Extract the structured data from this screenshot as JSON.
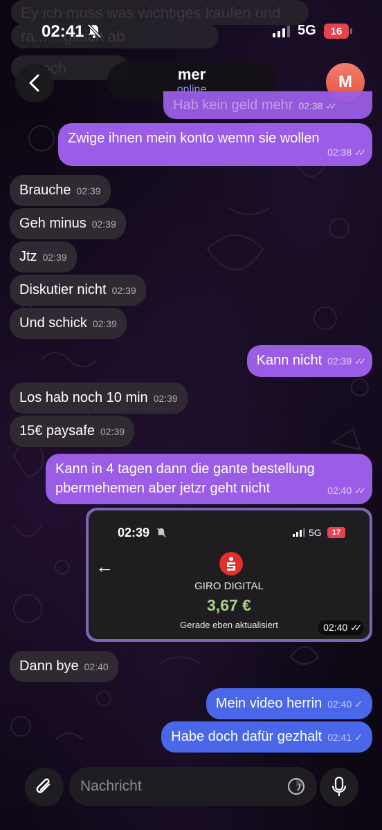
{
  "status_bar": {
    "time": "02:41",
    "network": "5G",
    "battery": "16"
  },
  "background_preview": {
    "line1": "Ey ich muss was wichtiges kaufen und",
    "line2": "ra... ...gleich ab",
    "line3": "...noch"
  },
  "header": {
    "contact_name": "mer",
    "contact_status": "online",
    "avatar_letter": "M"
  },
  "messages": [
    {
      "dir": "out",
      "text": "Hab kein geld mehr",
      "time": "02:38",
      "status": "read"
    },
    {
      "dir": "out",
      "text": "Zwige ihnen mein konto wemn sie wollen",
      "time": "02:38",
      "status": "read"
    },
    {
      "dir": "in",
      "text": "Brauche",
      "time": "02:39"
    },
    {
      "dir": "in",
      "text": "Geh minus",
      "time": "02:39"
    },
    {
      "dir": "in",
      "text": "Jtz",
      "time": "02:39"
    },
    {
      "dir": "in",
      "text": "Diskutier nicht",
      "time": "02:39"
    },
    {
      "dir": "in",
      "text": "Und schick",
      "time": "02:39"
    },
    {
      "dir": "out",
      "text": "Kann nicht",
      "time": "02:39",
      "status": "read"
    },
    {
      "dir": "in",
      "text": "Los hab noch 10 min",
      "time": "02:39"
    },
    {
      "dir": "in",
      "text": "15€ paysafe",
      "time": "02:39"
    },
    {
      "dir": "out",
      "text": "Kann in 4 tagen dann die gante bestellung pbermehemen aber jetzr geht nicht",
      "time": "02:40",
      "status": "read"
    },
    {
      "dir": "in",
      "text": "Dann bye",
      "time": "02:40"
    },
    {
      "dir": "out",
      "text": "Mein video herrin",
      "time": "02:40",
      "status": "sent"
    },
    {
      "dir": "out",
      "text": "Habe doch dafür gezhalt",
      "time": "02:41",
      "status": "sent"
    }
  ],
  "image_message": {
    "time": "02:40",
    "screenshot": {
      "time": "02:39",
      "network": "5G",
      "battery": "17",
      "bank_name": "GIRO DIGITAL",
      "balance": "3,67 €",
      "updated_text": "Gerade eben aktualisiert"
    }
  },
  "input": {
    "placeholder": "Nachricht"
  },
  "colors": {
    "outgoing_bubble": "#9b5de5",
    "outgoing_bubble_latest": "#4967e8",
    "incoming_bubble": "#2f2a32",
    "online_status": "#8d8cf0",
    "avatar": "#e9604c"
  }
}
